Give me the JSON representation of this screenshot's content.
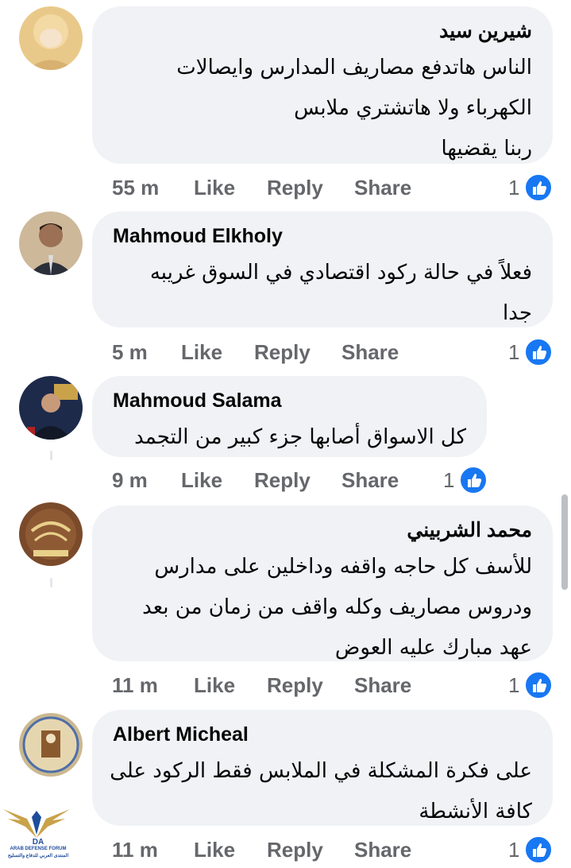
{
  "comments": [
    {
      "author": "شيرين سيد",
      "lines": [
        "الناس هاتدفع مصاريف المدارس وايصالات",
        "الكهرباء ولا هاتشتري ملابس",
        "ربنا يقضيها"
      ],
      "time": "55 m",
      "like_label": "Like",
      "reply_label": "Reply",
      "share_label": "Share",
      "reactions": "1"
    },
    {
      "author": "Mahmoud Elkholy",
      "lines": [
        "فعلاً في حالة ركود اقتصادي في السوق غريبه",
        "جدا"
      ],
      "time": "5 m",
      "like_label": "Like",
      "reply_label": "Reply",
      "share_label": "Share",
      "reactions": "1"
    },
    {
      "author": "Mahmoud Salama",
      "lines": [
        "كل الاسواق أصابها جزء كبير من التجمد"
      ],
      "time": "9 m",
      "like_label": "Like",
      "reply_label": "Reply",
      "share_label": "Share",
      "reactions": "1"
    },
    {
      "author": "محمد الشربيني",
      "lines": [
        "للأسف كل حاجه واقفه وداخلين على مدارس",
        "ودروس مصاريف وكله واقف من زمان من بعد",
        "عهد مبارك عليه العوض"
      ],
      "time": "11 m",
      "like_label": "Like",
      "reply_label": "Reply",
      "share_label": "Share",
      "reactions": "1"
    },
    {
      "author": "Albert Micheal",
      "lines": [
        "على فكرة المشكلة في الملابس فقط الركود على",
        "كافة الأنشطة"
      ],
      "time": "11 m",
      "like_label": "Like",
      "reply_label": "Reply",
      "share_label": "Share",
      "reactions": "1"
    }
  ],
  "watermark": {
    "logo_letters": "DA",
    "name": "ARAB DEFENSE FORUM",
    "subtitle": "المنتدى العربي للدفاع والتسليح"
  },
  "colors": {
    "bubble": "#f0f2f5",
    "meta_text": "#65676b",
    "like_blue": "#1877f2"
  }
}
